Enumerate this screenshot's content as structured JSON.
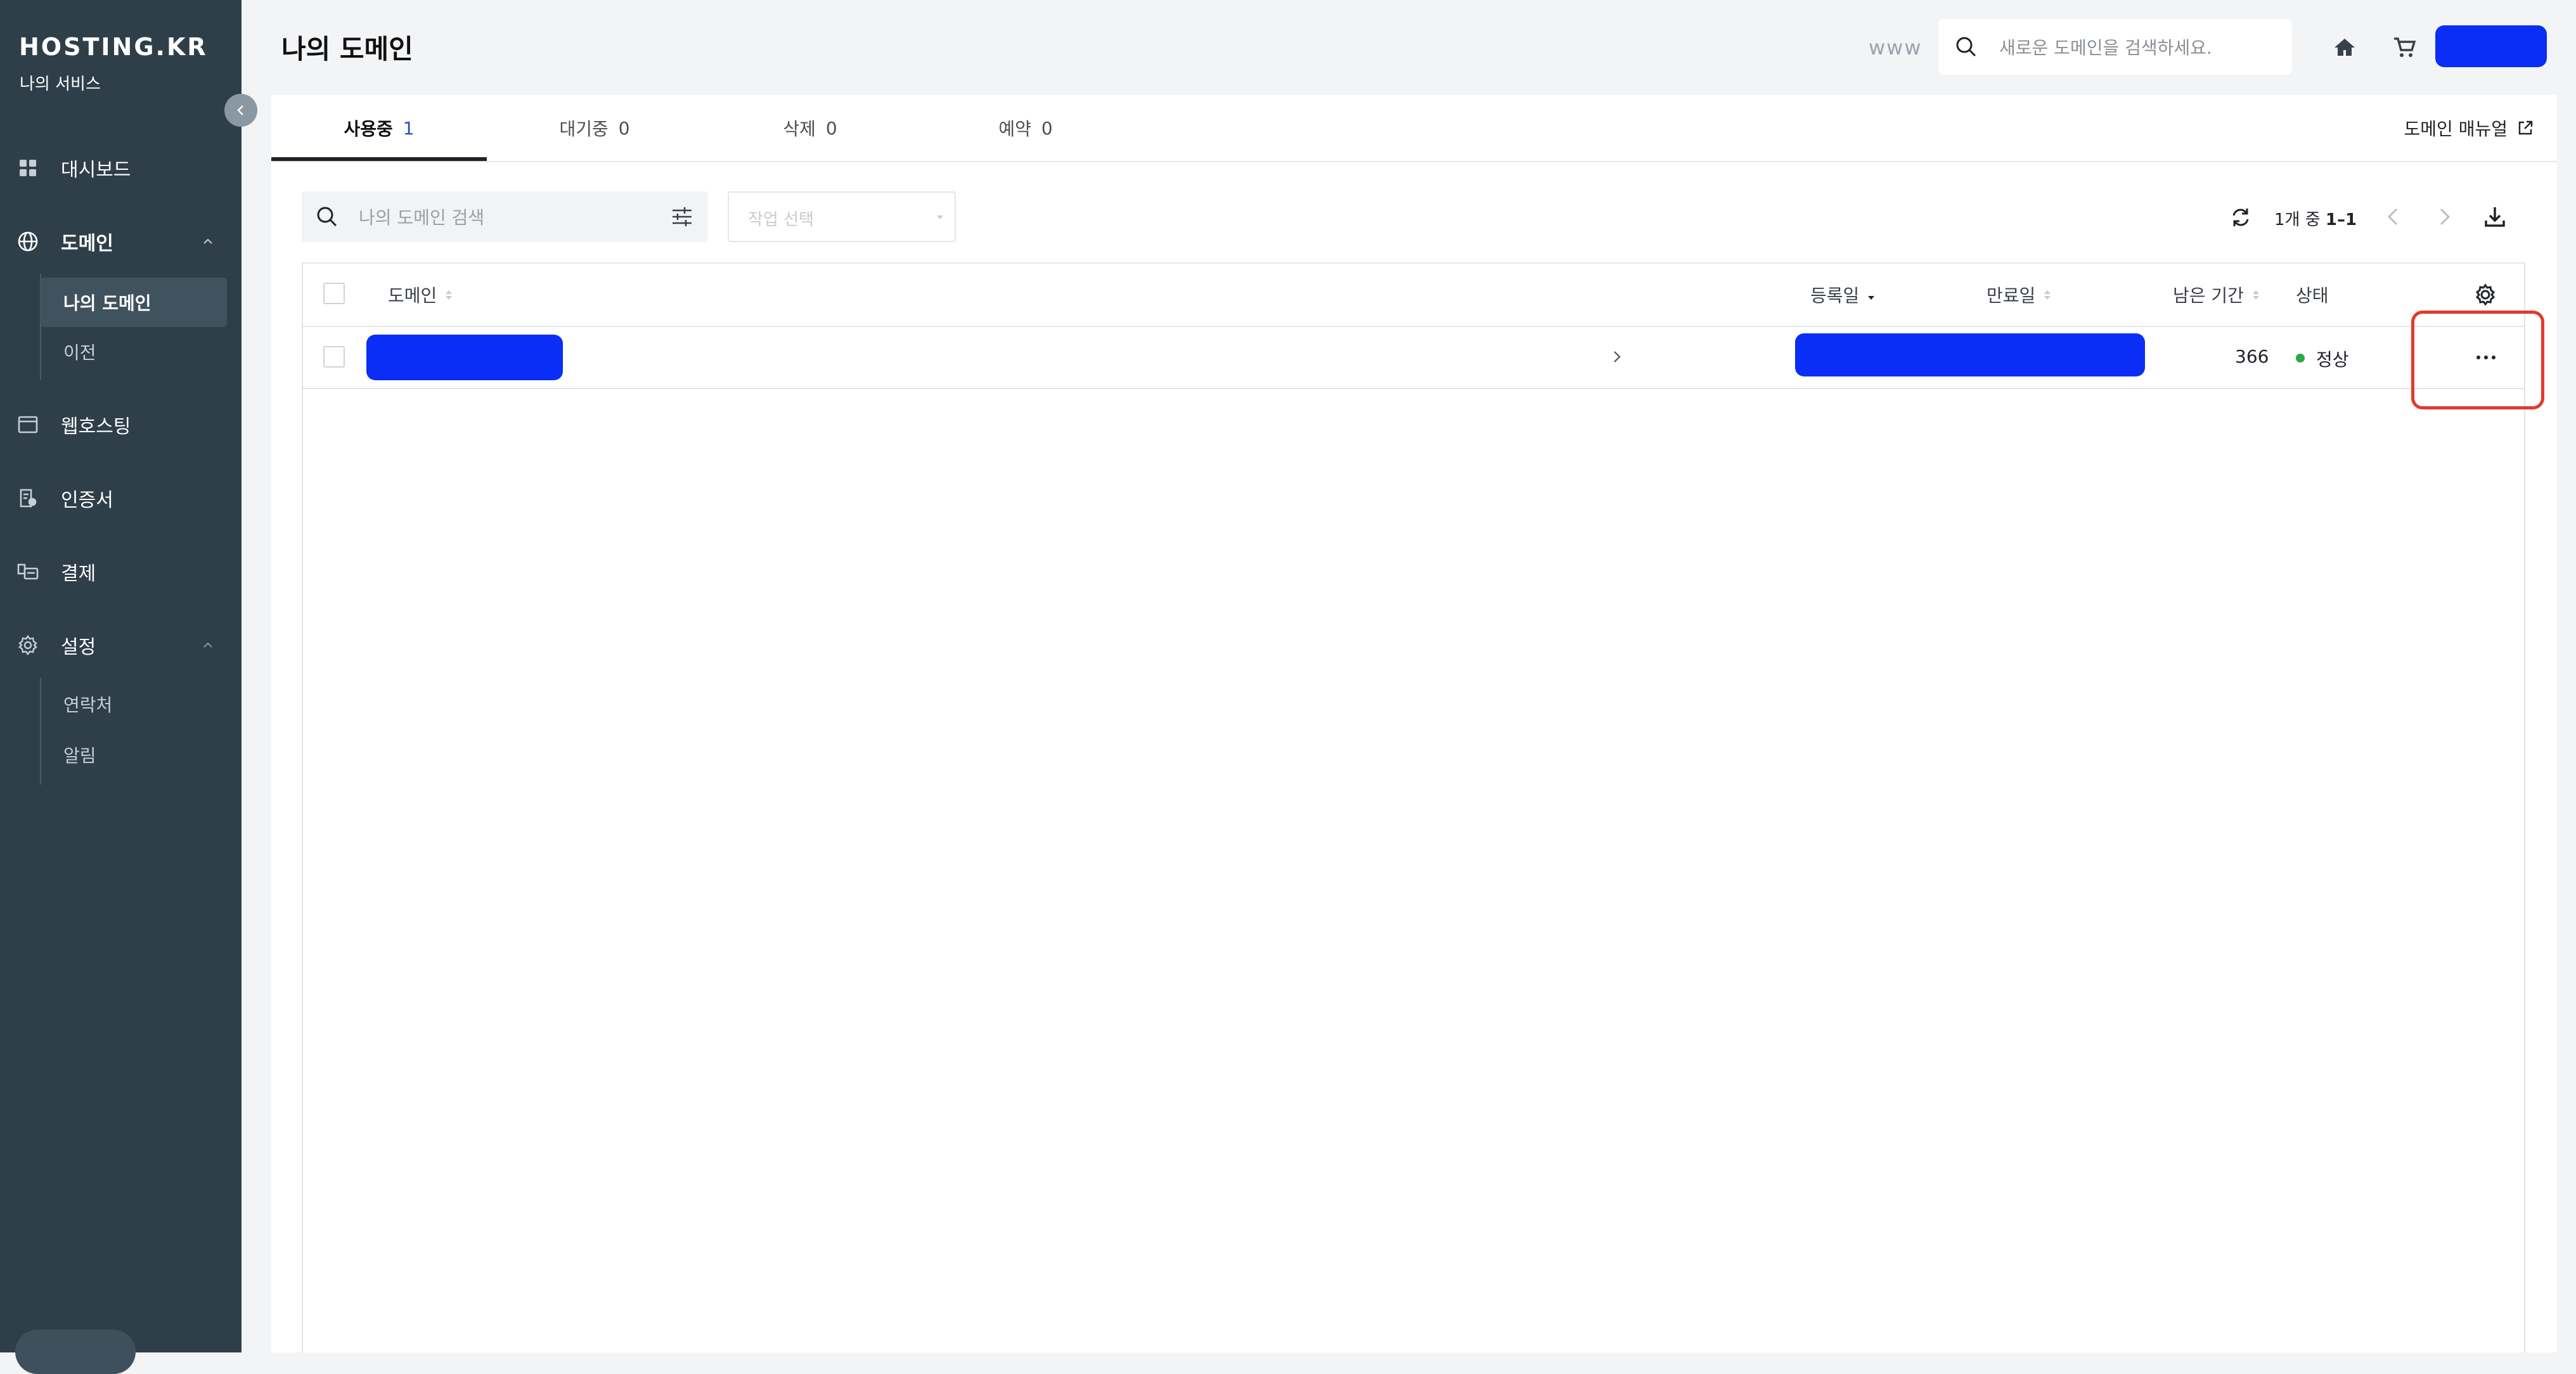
{
  "sidebar": {
    "brand": "HOSTING.KR",
    "subtitle": "나의 서비스",
    "items": [
      {
        "label": "대시보드",
        "icon": "dashboard-icon"
      },
      {
        "label": "도메인",
        "icon": "globe-icon"
      },
      {
        "label": "웹호스팅",
        "icon": "browser-window-icon"
      },
      {
        "label": "인증서",
        "icon": "certificate-icon"
      },
      {
        "label": "결제",
        "icon": "payment-icon"
      },
      {
        "label": "설정",
        "icon": "gear-icon"
      }
    ],
    "domain_sub": [
      {
        "label": "나의 도메인"
      },
      {
        "label": "이전"
      }
    ],
    "settings_sub": [
      {
        "label": "연락처"
      },
      {
        "label": "알림"
      }
    ]
  },
  "header": {
    "title": "나의 도메인",
    "www": "www",
    "search_placeholder": "새로운 도메인을 검색하세요."
  },
  "tabs": [
    {
      "label": "사용중",
      "count": "1"
    },
    {
      "label": "대기중",
      "count": "0"
    },
    {
      "label": "삭제",
      "count": "0"
    },
    {
      "label": "예약",
      "count": "0"
    }
  ],
  "manual_link": "도메인 매뉴얼",
  "toolbar": {
    "filter_placeholder": "나의 도메인 검색",
    "action_placeholder": "작업 선택",
    "pager_prefix": "1개 중",
    "pager_range": "1–1"
  },
  "table": {
    "columns": [
      "도메인",
      "등록일",
      "만료일",
      "남은 기간",
      "상태"
    ],
    "rows": [
      {
        "remaining": "366",
        "status": "정상"
      }
    ]
  },
  "colors": {
    "sidebar_bg": "#2e3f4a",
    "accent": "#0a2ef5",
    "status_ok": "#2ea84a",
    "highlight": "#e23a2e"
  }
}
